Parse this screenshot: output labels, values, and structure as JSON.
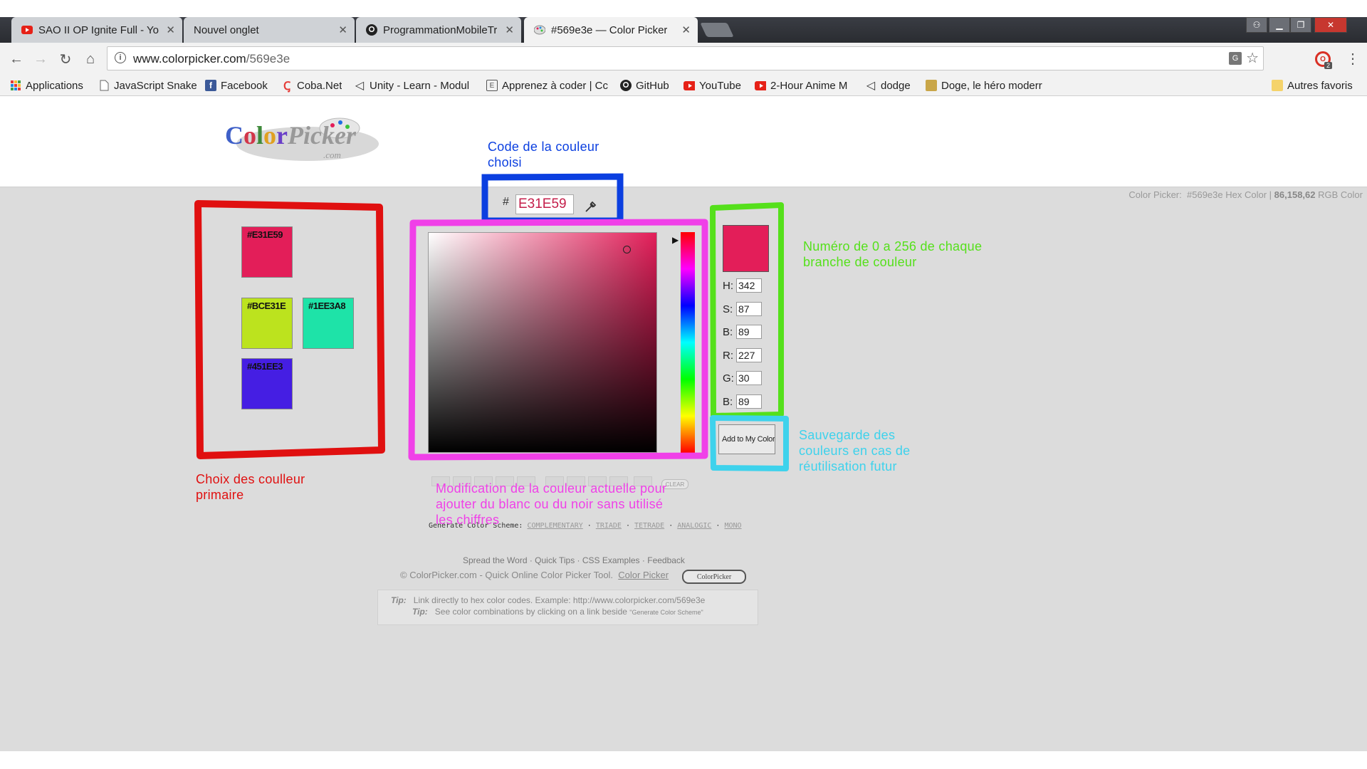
{
  "browser": {
    "tabs": [
      {
        "title": "SAO II OP Ignite Full - Yo",
        "icon": "youtube-icon"
      },
      {
        "title": "Nouvel onglet",
        "icon": ""
      },
      {
        "title": "ProgrammationMobileTr",
        "icon": "github-icon"
      },
      {
        "title": "#569e3e — Color Picker",
        "icon": "palette-icon",
        "active": true
      }
    ],
    "url_host": "www.colorpicker.com",
    "url_path": "/569e3e",
    "extension_badge": "2",
    "bookmarks": [
      {
        "label": "Applications",
        "icon": "apps-grid-icon",
        "color": "#4285f4"
      },
      {
        "label": "JavaScript Snake",
        "icon": "page-icon",
        "color": "#999999"
      },
      {
        "label": "Facebook",
        "icon": "facebook-icon",
        "color": "#3b5998"
      },
      {
        "label": "Coba.Net",
        "icon": "coba-icon",
        "color": "#e53935"
      },
      {
        "label": "Unity - Learn - Modul",
        "icon": "unity-icon",
        "color": "#333333"
      },
      {
        "label": "Apprenez à coder | Cc",
        "icon": "page-icon",
        "color": "#555555"
      },
      {
        "label": "GitHub",
        "icon": "github-icon",
        "color": "#222222"
      },
      {
        "label": "YouTube",
        "icon": "youtube-icon",
        "color": "#e62117"
      },
      {
        "label": "2-Hour Anime M",
        "icon": "youtube-icon",
        "color": "#e62117"
      },
      {
        "label": "dodge",
        "icon": "unity-icon",
        "color": "#333333"
      },
      {
        "label": "Doge, le héro moderr",
        "icon": "doge-icon",
        "color": "#c9a648"
      }
    ],
    "other_bookmarks": "Autres favoris"
  },
  "page": {
    "logo_text": "ColorPicker",
    "logo_sub": ".com",
    "status": {
      "prefix": "Color Picker:",
      "hex": "#569e3e",
      "hex_label": "Hex Color |",
      "rgb": "86,158,62",
      "rgb_label": "RGB Color"
    },
    "swatches": [
      {
        "hex": "#E31E59",
        "color": "#e31e59"
      },
      {
        "hex": "#BCE31E",
        "color": "#bce31e"
      },
      {
        "hex": "#1EE3A8",
        "color": "#1ee3a8"
      },
      {
        "hex": "#451EE3",
        "color": "#451ee3"
      }
    ],
    "hash": "#",
    "hex_value": "E31E59",
    "current_color": "#e31e59",
    "fields": [
      {
        "label": "H:",
        "value": "342"
      },
      {
        "label": "S:",
        "value": "87"
      },
      {
        "label": "B:",
        "value": "89"
      },
      {
        "label": "R:",
        "value": "227"
      },
      {
        "label": "G:",
        "value": "30"
      },
      {
        "label": "B:",
        "value": "89"
      }
    ],
    "save_button": "Add to My Colors",
    "clear_button": "CLEAR",
    "scheme_label": "Generate Color Scheme:",
    "scheme_links": [
      "COMPLEMENTARY",
      "TRIADE",
      "TETRADE",
      "ANALOGIC",
      "MONO"
    ],
    "footer_links": [
      "Spread the Word",
      "Quick Tips",
      "CSS Examples",
      "Feedback"
    ],
    "footer_copy": "© ColorPicker.com - Quick Online Color Picker Tool.",
    "footer_copy_link": "Color Picker",
    "footer_badge": "ColorPicker",
    "tips": [
      {
        "label": "Tip:",
        "text": "Link directly to hex color codes.   Example:  http://www.colorpicker.com/569e3e"
      },
      {
        "label": "Tip:",
        "text": "See color combinations by clicking on a link beside",
        "small": "\"Generate Color Scheme\""
      }
    ]
  },
  "annotations": {
    "hex_code": {
      "text": "Code de la couleur choisi",
      "color": "#0b3fe0"
    },
    "branches": {
      "text": "Numéro de 0 a 256 de chaque branche de couleur",
      "color": "#55e01b"
    },
    "save": {
      "text": "Sauvegarde des couleurs en cas de réutilisation futur",
      "color": "#3ed2ec"
    },
    "primary": {
      "text": "Choix des coulleur primaire",
      "color": "#e01010"
    },
    "modify": {
      "text": "Modification de la couleur actuelle pour ajouter du blanc ou du noir sans utilisé les chiffres",
      "color": "#f040e8"
    }
  }
}
